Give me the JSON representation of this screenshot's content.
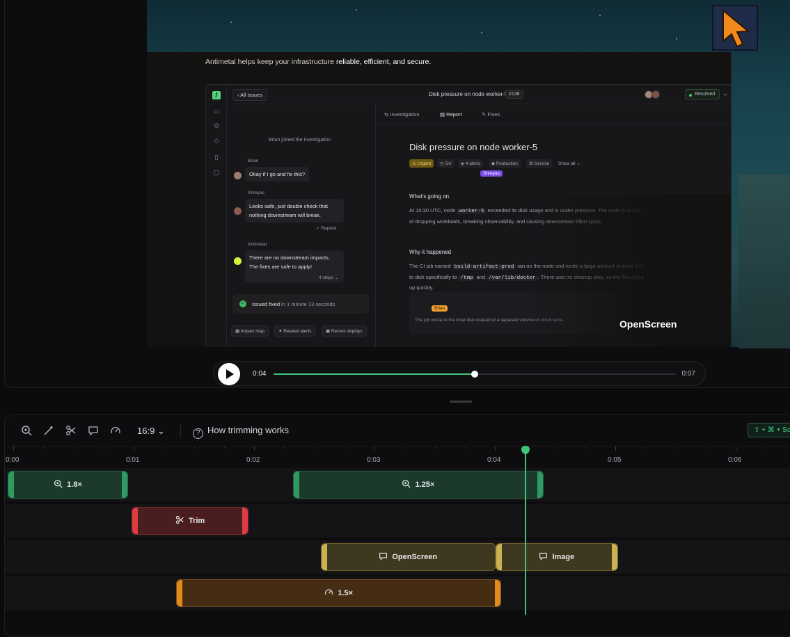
{
  "preview": {
    "tagline_plain": "Antimetal helps keep your infrastructure ",
    "tagline_bold": "reliable, efficient, and secure.",
    "watermark": "OpenScreen",
    "app": {
      "back_label": "All issues",
      "issue_title": "Disk pressure on node worker-5",
      "issue_number": "#138",
      "status": "Resolved",
      "chat": {
        "system_msg": "Brian joined the investigation",
        "messages": [
          {
            "author": "Brian",
            "text": "Okay if I go and fix this?"
          },
          {
            "author": "Shreyas",
            "text_1": "Looks safe, just double check that",
            "text_2": "nothing downstream will break.",
            "meta": "Replied"
          },
          {
            "author": "Antimetal",
            "text_1": "There are no downstream impacts.",
            "text_2": "The fixes are safe to apply!",
            "meta": "4 steps"
          }
        ],
        "fixed_main": "Issued fixed",
        "fixed_sub": " in 1 minute 13 seconds",
        "chips": [
          "Impact map",
          "Related alerts",
          "Recent deploys"
        ]
      },
      "report": {
        "tabs": [
          "Investigation",
          "Report",
          "Fixes"
        ],
        "title": "Disk pressure on node worker-5",
        "tags": [
          "Urgent",
          "5m",
          "4 alerts",
          "Production",
          "Service",
          "Show all"
        ],
        "cursor_shreyas": "Shreyas",
        "cursor_brian": "Brian",
        "h_whats_going_on": "What's going on",
        "p1_a": "At 10:30 UTC, node ",
        "p1_code": "worker-5",
        "p1_b": " exceeded its disk usage and is under pressure. The node is at risk of dropping workloads, breaking observability, and causing downstream blind spots.",
        "h_why": "Why it happened",
        "p2_a": "The CI job named ",
        "p2_code1": "build-artifact-prod",
        "p2_b": " ran on the node and wrote a large amount of build files to disk specifically to ",
        "p2_code2": "/tmp",
        "p2_c": " and ",
        "p2_code3": "/var/lib/docker",
        "p2_d": ". There was no cleanup step, so the files piled up quickly.",
        "card_text": "The job wrote to the local disk instead of a separate volume or cloud store."
      }
    }
  },
  "player": {
    "current_time": "0:04",
    "end_time": "0:07",
    "progress": 0.5
  },
  "toolbar": {
    "aspect_ratio": "16:9",
    "howto_label": "How trimming works",
    "shortcut": "⇧ + ⌘ + Sc",
    "icons": [
      "zoom-in-icon",
      "magic-wand-icon",
      "scissors-icon",
      "comment-icon",
      "gauge-icon"
    ]
  },
  "timeline": {
    "ticks": [
      "0:00",
      "0:01",
      "0:02",
      "0:03",
      "0:04",
      "0:05",
      "0:06"
    ],
    "playhead_time_s": 4.27,
    "clips": {
      "zoom_1": {
        "label": "1.8×",
        "start_s": 0.0,
        "end_s": 1.0
      },
      "zoom_2": {
        "label": "1.25×",
        "start_s": 2.37,
        "end_s": 4.45
      },
      "trim_1": {
        "label": "Trim",
        "start_s": 1.03,
        "end_s": 2.0
      },
      "annotation_1": {
        "label": "OpenScreen",
        "start_s": 2.6,
        "end_s": 4.05
      },
      "annotation_2": {
        "label": "Image",
        "start_s": 4.05,
        "end_s": 5.07
      },
      "speed_1": {
        "label": "1.5×",
        "start_s": 1.4,
        "end_s": 4.1
      }
    }
  },
  "colors": {
    "accent": "#3ec57a",
    "zoom": "#2e9b61",
    "trim": "#dd3d42",
    "annotation": "#c8b251",
    "speed": "#e38a1c"
  }
}
